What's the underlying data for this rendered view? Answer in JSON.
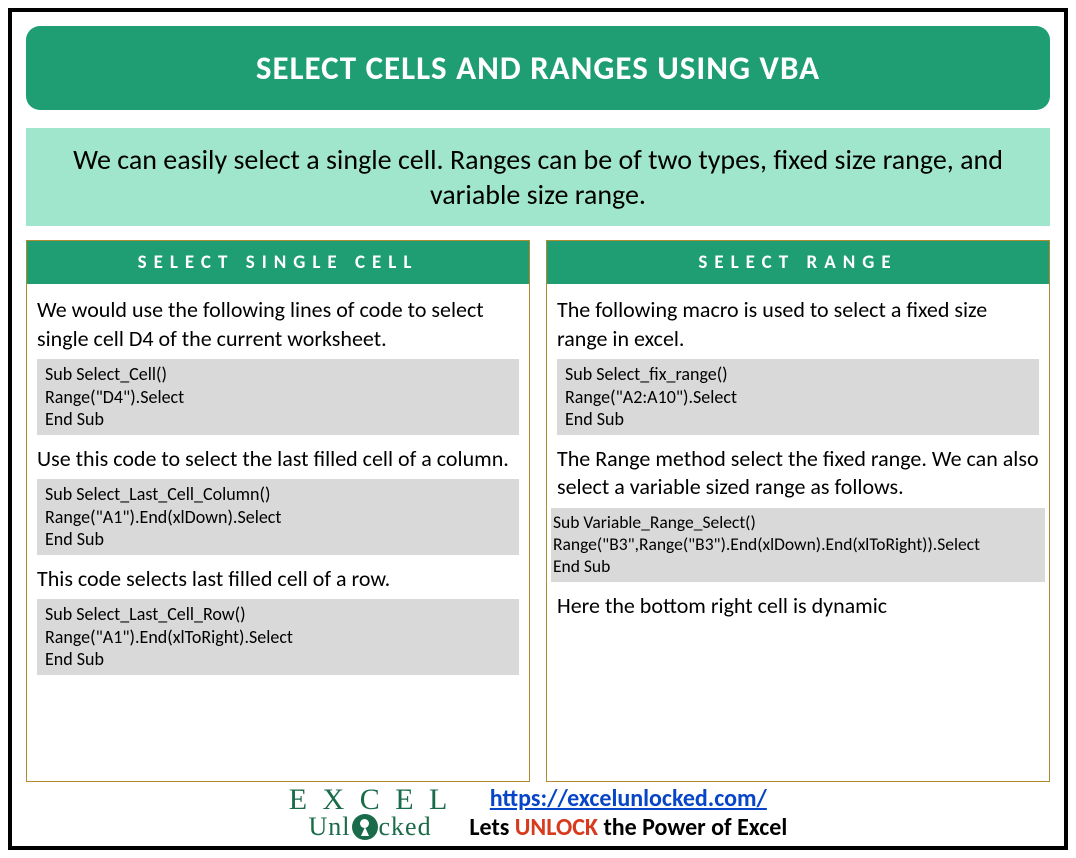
{
  "title": "SELECT CELLS AND RANGES USING VBA",
  "intro": "We can easily select a single cell. Ranges can be of two types, fixed size range, and variable size range.",
  "left": {
    "header": "SELECT SINGLE CELL",
    "desc1": "We would use the following lines of code to select single cell D4 of the current worksheet.",
    "code1": "Sub Select_Cell()\nRange(\"D4\").Select\nEnd Sub",
    "desc2": "Use this code to select the last filled cell of a column.",
    "code2": "Sub Select_Last_Cell_Column()\nRange(\"A1\").End(xlDown).Select\nEnd Sub",
    "desc3": "This code selects last filled cell of a row.",
    "code3": "Sub Select_Last_Cell_Row()\nRange(\"A1\").End(xlToRight).Select\nEnd Sub"
  },
  "right": {
    "header": "SELECT RANGE",
    "desc1": "The following macro is used to select a fixed size range in excel.",
    "code1": "Sub Select_fix_range()\nRange(\"A2:A10\").Select\nEnd Sub",
    "desc2": "The Range method select the fixed range. We can also select a variable sized range as follows.",
    "code2": "Sub Variable_Range_Select()\nRange(\"B3\",Range(\"B3\").End(xlDown).End(xlToRight)).Select\nEnd Sub",
    "desc3": "Here the bottom right cell is dynamic"
  },
  "footer": {
    "logo_top": "E X C E L",
    "logo_bottom_pre": "Unl",
    "logo_bottom_post": "cked",
    "url": "https://excelunlocked.com/",
    "tag_pre": "Lets ",
    "tag_highlight": "UNLOCK",
    "tag_post": " the Power of Excel"
  }
}
